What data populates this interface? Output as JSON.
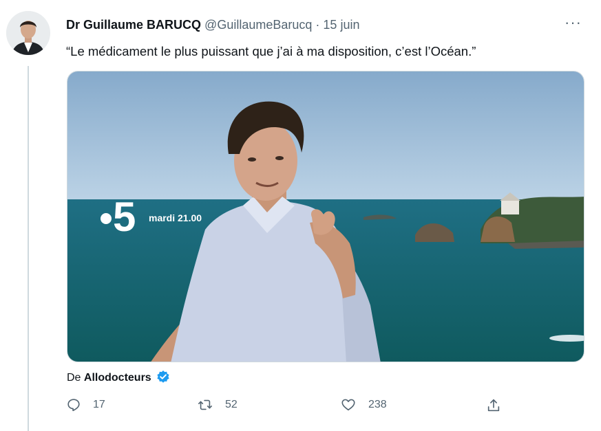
{
  "tweet": {
    "author_name": "Dr Guillaume BARUCQ",
    "author_handle": "@GuillaumeBarucq",
    "separator": "·",
    "date": "15 juin",
    "more": "···",
    "text": "“Le médicament le plus puissant que j’ai à ma disposition, c’est l’Océan.”"
  },
  "media": {
    "channel_logo_text": "•5",
    "broadcast_text": "mardi 21.00"
  },
  "source": {
    "prefix": "De",
    "account": "Allodocteurs"
  },
  "actions": {
    "reply_count": "17",
    "retweet_count": "52",
    "like_count": "238"
  },
  "colors": {
    "text_primary": "#0f1419",
    "text_secondary": "#536471",
    "verified_blue": "#1d9bf0",
    "thread_line": "#cfd9de"
  }
}
